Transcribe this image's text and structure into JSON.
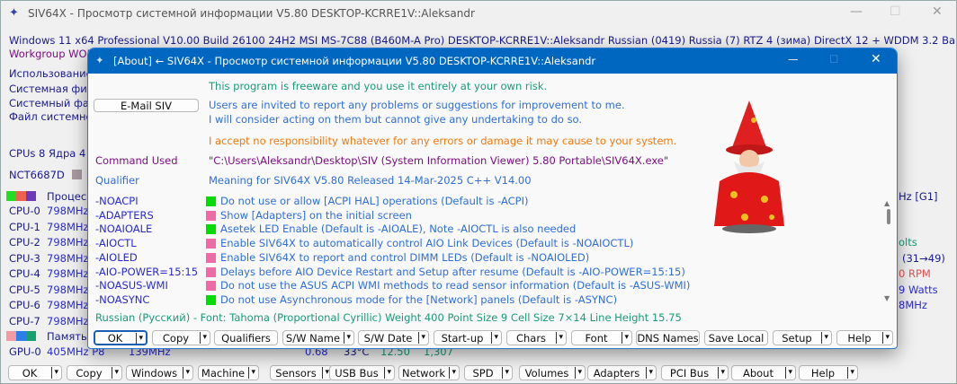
{
  "main": {
    "title": "SIV64X - Просмотр системной информации V5.80 DESKTOP-KCRRE1V::Aleksandr",
    "info_line": "Windows 11 x64 Professional  V10.00  Build 26100  24H2  MSI MS-7C88 (B460M-A Pro)  DESKTOP-KCRRE1V::Aleksandr  Russian (0419)  Russia (7)  RTZ 4 (зима)  DirectX 12 + WDDM 3.2  Ba",
    "workgroup": "Workgroup WOR",
    "left_lines": [
      "Использование",
      "Системная физ",
      "Системный фай",
      "Файл системно"
    ],
    "cpus": "CPUs 8 Ядра 4",
    "sensor_chip": "NCT6687D",
    "processor_label": "Процесс",
    "cpus_list": [
      {
        "n": "CPU-0",
        "f": "798MHz"
      },
      {
        "n": "CPU-1",
        "f": "798MHz"
      },
      {
        "n": "CPU-2",
        "f": "798MHz"
      },
      {
        "n": "CPU-3",
        "f": "798MHz"
      },
      {
        "n": "CPU-4",
        "f": "798MHz"
      },
      {
        "n": "CPU-5",
        "f": "798MHz"
      },
      {
        "n": "CPU-6",
        "f": "798MHz"
      },
      {
        "n": "CPU-7",
        "f": "798MHz"
      }
    ],
    "memory_label": "Память",
    "gpu": {
      "name": "GPU-0",
      "freq": "405MHz P8",
      "mem": "139MHz"
    },
    "partial_row": [
      "0.68",
      "33°C",
      "12.50",
      "1,307"
    ],
    "right_fragments": [
      "Hz [G1]",
      "olts",
      "(31→49)",
      "0 RPM",
      "9 Watts",
      "8MHz"
    ],
    "buttons": [
      "OK",
      "Copy",
      "Windows",
      "Machine",
      "Sensors",
      "USB Bus",
      "Network",
      "SPD",
      "Volumes",
      "Adapters",
      "PCI Bus",
      "About",
      "Help"
    ]
  },
  "dialog": {
    "title": "[About] ← SIV64X - Просмотр системной информации V5.80 DESKTOP-KCRRE1V::Aleksandr",
    "freeware": "This program is freeware and you use it entirely at your own risk.",
    "email_button": "E-Mail SIV",
    "invite1": "Users are invited to report any problems or suggestions for improvement to me.",
    "invite2": "I will consider acting on them but cannot give any undertaking to do so.",
    "disclaimer": "I accept no responsibility whatever for any errors or damage it may cause to your system.",
    "command_label": "Command Used",
    "command_value": "\"C:\\Users\\Aleksandr\\Desktop\\SIV (System Information Viewer) 5.80 Portable\\SIV64X.exe\"",
    "qualifier_label": "Qualifier",
    "qualifier_value": "Meaning for SIV64X V5.80  Released 14-Mar-2025 C++ V14.00",
    "options": [
      {
        "q": "-NOACPI",
        "d": "Do not use or allow [ACPI HAL] operations (Default is -ACPI)",
        "c": "#00dd00"
      },
      {
        "q": "-ADAPTERS",
        "d": "Show [Adapters] on the initial screen",
        "c": "#f06aa8"
      },
      {
        "q": "-NOAIOALE",
        "d": "Asetek LED Enable (Default is -AIOALE), Note -AIOCTL is also needed",
        "c": "#00dd00"
      },
      {
        "q": "-AIOCTL",
        "d": "Enable SIV64X to automatically control AIO Link Devices (Default is -NOAIOCTL)",
        "c": "#f06aa8"
      },
      {
        "q": "-AIOLED",
        "d": "Enable SIV64X to report and control DIMM LEDs (Default is -NOAIOLED)",
        "c": "#f06aa8"
      },
      {
        "q": "-AIO-POWER=15:15",
        "d": "Delays before AIO Device Restart and Setup after resume (Default is -AIO-POWER=15:15)",
        "c": "#f06aa8"
      },
      {
        "q": "-NOASUS-WMI",
        "d": "Do not use the ASUS ACPI WMI methods to read sensor information (Default is -ASUS-WMI)",
        "c": "#f06aa8"
      },
      {
        "q": "-NOASYNC",
        "d": "Do not use Asynchronous mode for the [Network] panels (Default is -ASYNC)",
        "c": "#00dd00"
      }
    ],
    "font_info": "Russian (Русский) - Font: Tahoma (Proportional Cyrillic)  Weight 400  Point Size 9  Cell Size 7×14  Line Height 15.75",
    "buttons": [
      "OK",
      "Copy",
      "Qualifiers",
      "S/W Name",
      "S/W Date",
      "Start-up",
      "Chars",
      "Font",
      "DNS Names",
      "Save Local",
      "Setup",
      "Help"
    ]
  }
}
